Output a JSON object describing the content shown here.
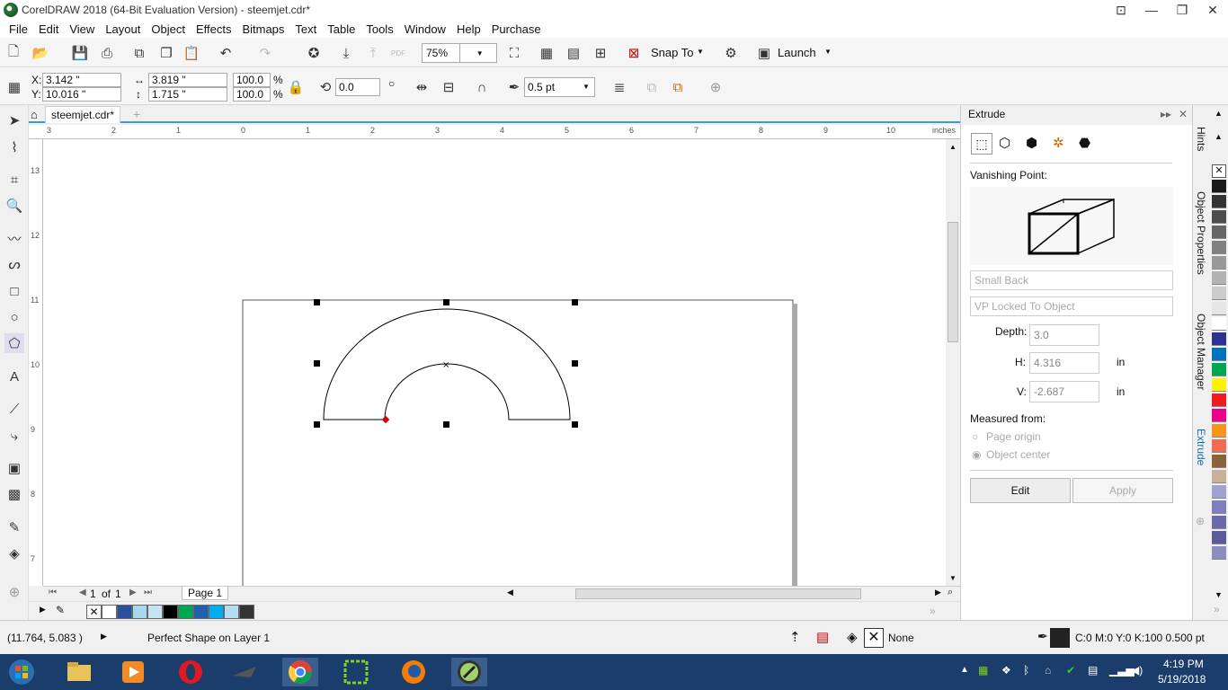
{
  "window": {
    "title": "CorelDRAW 2018 (64-Bit Evaluation Version) - steemjet.cdr*"
  },
  "menu": [
    "File",
    "Edit",
    "View",
    "Layout",
    "Object",
    "Effects",
    "Bitmaps",
    "Text",
    "Table",
    "Tools",
    "Window",
    "Help",
    "Purchase"
  ],
  "toolbar": {
    "zoom": "75%",
    "snap_label": "Snap To",
    "launch_label": "Launch",
    "pdf_label": "PDF"
  },
  "propbar": {
    "x": "3.142 \"",
    "y": "10.016 \"",
    "w": "3.819 \"",
    "h": "1.715 \"",
    "sx": "100.0",
    "sy": "100.0",
    "pct": "%",
    "rotation": "0.0",
    "outline": "0.5 pt",
    "x_label": "X:",
    "y_label": "Y:"
  },
  "document": {
    "tab": "steemjet.cdr*",
    "unit": "inches"
  },
  "rulers": {
    "h_ticks": [
      "3",
      "2",
      "1",
      "0",
      "1",
      "2",
      "3",
      "4",
      "5",
      "6",
      "7",
      "8",
      "9",
      "10"
    ],
    "v_ticks": [
      "13",
      "12",
      "11",
      "10",
      "9",
      "8",
      "7"
    ]
  },
  "pagenav": {
    "current": "1",
    "of": "of",
    "total": "1",
    "page_name": "Page 1"
  },
  "docker": {
    "title": "Extrude",
    "vanishing_label": "Vanishing Point:",
    "type_value": "Small Back",
    "vp_value": "VP Locked To Object",
    "depth_label": "Depth:",
    "depth": "3.0",
    "h_label": "H:",
    "h": "4.316",
    "h_unit": "in",
    "v_label": "V:",
    "v": "-2.687",
    "v_unit": "in",
    "measured_label": "Measured from:",
    "opt_page": "Page origin",
    "opt_object": "Object center",
    "edit_btn": "Edit",
    "apply_btn": "Apply"
  },
  "docker_tabs": [
    "Hints",
    "Object Properties",
    "Object Manager",
    "Extrude"
  ],
  "status": {
    "coords": "(11.764, 5.083 )",
    "message": "Perfect Shape on Layer 1",
    "fill": "None",
    "outline": "C:0 M:0 Y:0 K:100  0.500 pt"
  },
  "taskbar": {
    "time": "4:19 PM",
    "date": "5/19/2018"
  },
  "colors": {
    "accent": "#3a9ad9",
    "taskbar": "#1b3d6b",
    "selection_handle": "#000000",
    "node": "#d00000"
  },
  "doc_palette": [
    "none",
    "#ffffff",
    "#2a4f9b",
    "#a9d8ea",
    "#c6e4ef",
    "#000000",
    "#00a651",
    "#1f5fb0",
    "#00aeef",
    "#b3def2",
    "#333333"
  ],
  "color_palette": [
    "none",
    "#1a1a1a",
    "#333333",
    "#4d4d4d",
    "#666666",
    "#808080",
    "#999999",
    "#b3b3b3",
    "#cccccc",
    "#e6e6e6",
    "#ffffff",
    "#2e3192",
    "#0072bc",
    "#00a651",
    "#fff200",
    "#ed1c24",
    "#ec008c",
    "#f7941d",
    "#f26c4f",
    "#8c6239",
    "#c7b299",
    "#a3a1d1",
    "#7f7fbf",
    "#6a6aa8",
    "#5b5b9a",
    "#8c8cc0"
  ]
}
